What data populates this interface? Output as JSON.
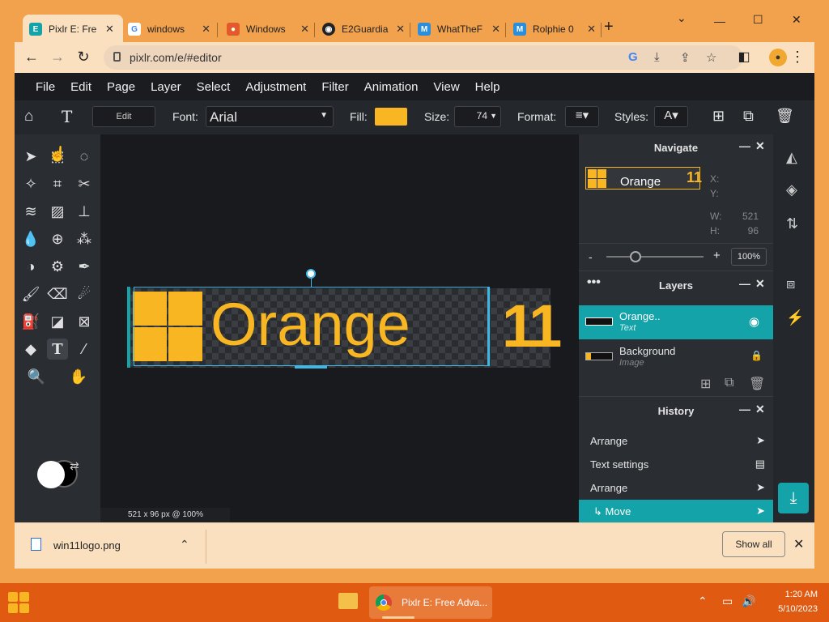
{
  "browser": {
    "tabs": [
      {
        "title": "Pixlr E: Fre",
        "icon": "pixlr-icon",
        "active": true
      },
      {
        "title": "windows",
        "icon": "google-icon",
        "active": false
      },
      {
        "title": "Windows",
        "icon": "firefox-icon",
        "active": false
      },
      {
        "title": "E2Guardia",
        "icon": "globe-icon",
        "active": false
      },
      {
        "title": "WhatTheF",
        "icon": "whatthefont-icon",
        "active": false
      },
      {
        "title": "Rolphie 0",
        "icon": "whatthefont-icon",
        "active": false
      }
    ],
    "new_tab": "+",
    "url": "pixlr.com/e/#editor",
    "window_controls": {
      "minimize": "—",
      "maximize": "☐",
      "close": "✕"
    }
  },
  "app": {
    "menu": [
      "File",
      "Edit",
      "Page",
      "Layer",
      "Select",
      "Adjustment",
      "Filter",
      "Animation",
      "View",
      "Help"
    ],
    "options": {
      "edit_button": "Edit",
      "font_label": "Font:",
      "font_value": "Arial",
      "fill_label": "Fill:",
      "fill_color": "#f9b623",
      "size_label": "Size:",
      "size_value": "74",
      "format_label": "Format:",
      "styles_label": "Styles:"
    },
    "canvas": {
      "text": "Orange",
      "extra_text": "11",
      "status": "521 x 96 px @ 100%"
    },
    "navigate": {
      "title": "Navigate",
      "thumb_text": "Orange",
      "thumb_num": "11",
      "x_label": "X:",
      "y_label": "Y:",
      "w_label": "W:",
      "w_value": "521",
      "h_label": "H:",
      "h_value": "96",
      "zoom_minus": "-",
      "zoom_plus": "+",
      "zoom_value": "100%",
      "zoom_slider_level": 0.3
    },
    "layers": {
      "title": "Layers",
      "items": [
        {
          "name": "Orange..",
          "type": "Text",
          "selected": true
        },
        {
          "name": "Background",
          "type": "Image",
          "selected": false
        }
      ]
    },
    "history": {
      "title": "History",
      "items": [
        {
          "label": "Arrange",
          "icon": "cursor-icon",
          "selected": false
        },
        {
          "label": "Text settings",
          "icon": "document-icon",
          "selected": false
        },
        {
          "label": "Arrange",
          "icon": "cursor-icon",
          "selected": false
        },
        {
          "label": "↳ Move",
          "icon": "cursor-icon",
          "selected": true
        }
      ]
    },
    "accent": "#14a3a8"
  },
  "download": {
    "file": "win11logo.png",
    "show_all": "Show all"
  },
  "taskbar": {
    "app_label": "Pixlr E: Free Adva...",
    "time": "1:20 AM",
    "date": "5/10/2023"
  }
}
